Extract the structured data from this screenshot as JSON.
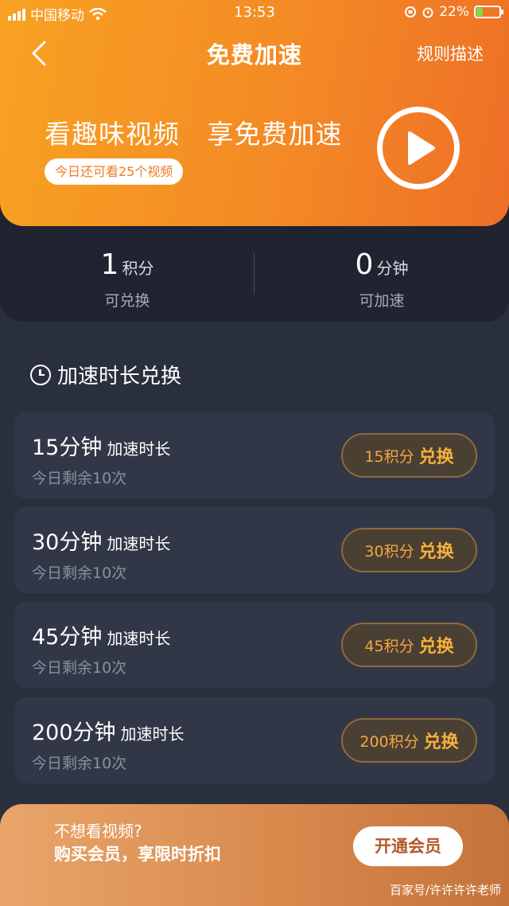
{
  "status_bar": {
    "carrier": "中国移动",
    "time": "13:53",
    "battery": "22%"
  },
  "nav": {
    "title": "免费加速",
    "rules": "规则描述"
  },
  "hero": {
    "headline": "看趣味视频   享免费加速",
    "pill": "今日还可看25个视频"
  },
  "stats": {
    "points": {
      "value": "1",
      "unit": "积分",
      "label": "可兑换"
    },
    "minutes": {
      "value": "0",
      "unit": "分钟",
      "label": "可加速"
    }
  },
  "section": {
    "title": "加速时长兑换"
  },
  "cards": [
    {
      "duration": "15分钟",
      "sub": "加速时长",
      "remaining": "今日剩余10次",
      "cost": "15积分",
      "action": "兑换"
    },
    {
      "duration": "30分钟",
      "sub": "加速时长",
      "remaining": "今日剩余10次",
      "cost": "30积分",
      "action": "兑换"
    },
    {
      "duration": "45分钟",
      "sub": "加速时长",
      "remaining": "今日剩余10次",
      "cost": "45积分",
      "action": "兑换"
    },
    {
      "duration": "200分钟",
      "sub": "加速时长",
      "remaining": "今日剩余10次",
      "cost": "200积分",
      "action": "兑换"
    }
  ],
  "promo": {
    "line1": "不想看视频?",
    "line2": "购买会员，享限时折扣",
    "button": "开通会员"
  },
  "watermark": "百家号/许许许许老师",
  "colors": {
    "accent": "#f48a25",
    "button_text": "#f8b13a",
    "background": "#2a2f3d"
  }
}
